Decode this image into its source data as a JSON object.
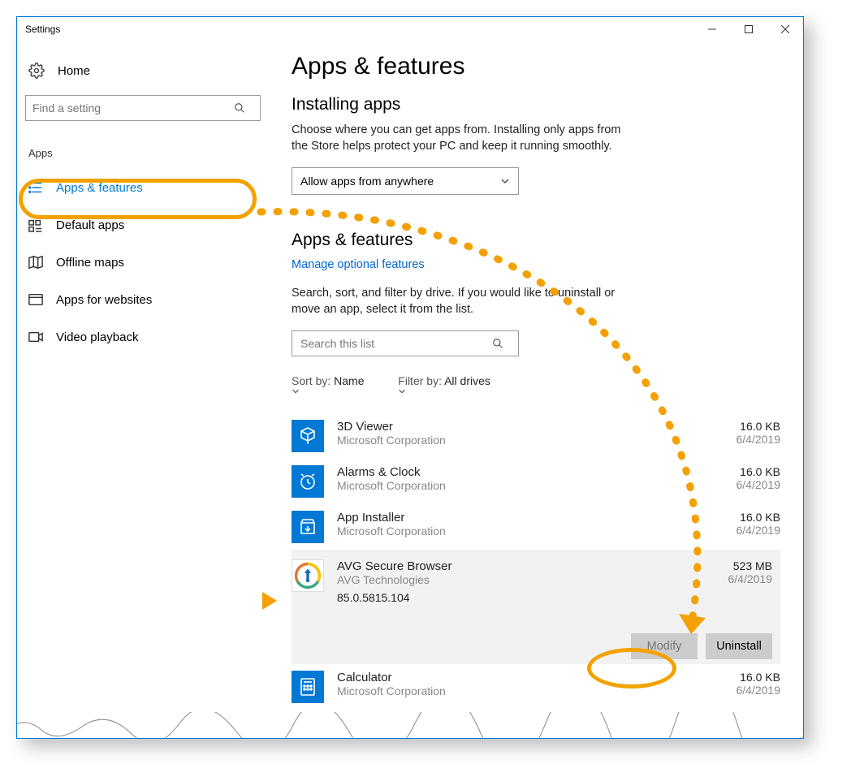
{
  "titlebar": {
    "title": "Settings"
  },
  "sidebar": {
    "home": "Home",
    "search_placeholder": "Find a setting",
    "section": "Apps",
    "items": [
      {
        "label": "Apps & features"
      },
      {
        "label": "Default apps"
      },
      {
        "label": "Offline maps"
      },
      {
        "label": "Apps for websites"
      },
      {
        "label": "Video playback"
      }
    ]
  },
  "page": {
    "title": "Apps & features",
    "installing": {
      "heading": "Installing apps",
      "desc": "Choose where you can get apps from. Installing only apps from the Store helps protect your PC and keep it running smoothly.",
      "dropdown_value": "Allow apps from anywhere"
    },
    "features": {
      "heading": "Apps & features",
      "manage_link": "Manage optional features",
      "desc": "Search, sort, and filter by drive. If you would like to uninstall or move an app, select it from the list.",
      "list_search_placeholder": "Search this list",
      "sort_label": "Sort by:",
      "sort_value": "Name",
      "filter_label": "Filter by:",
      "filter_value": "All drives"
    }
  },
  "apps": [
    {
      "name": "3D Viewer",
      "publisher": "Microsoft Corporation",
      "size": "16.0 KB",
      "date": "6/4/2019",
      "icon_color": "#0078d4"
    },
    {
      "name": "Alarms & Clock",
      "publisher": "Microsoft Corporation",
      "size": "16.0 KB",
      "date": "6/4/2019",
      "icon_color": "#0078d4"
    },
    {
      "name": "App Installer",
      "publisher": "Microsoft Corporation",
      "size": "16.0 KB",
      "date": "6/4/2019",
      "icon_color": "#0078d4"
    },
    {
      "name": "AVG Secure Browser",
      "publisher": "AVG Technologies",
      "size": "523 MB",
      "date": "6/4/2019",
      "version": "85.0.5815.104",
      "selected": true
    },
    {
      "name": "Calculator",
      "publisher": "Microsoft Corporation",
      "size": "16.0 KB",
      "date": "6/4/2019",
      "icon_color": "#0078d4"
    }
  ],
  "actions": {
    "modify": "Modify",
    "uninstall": "Uninstall"
  }
}
